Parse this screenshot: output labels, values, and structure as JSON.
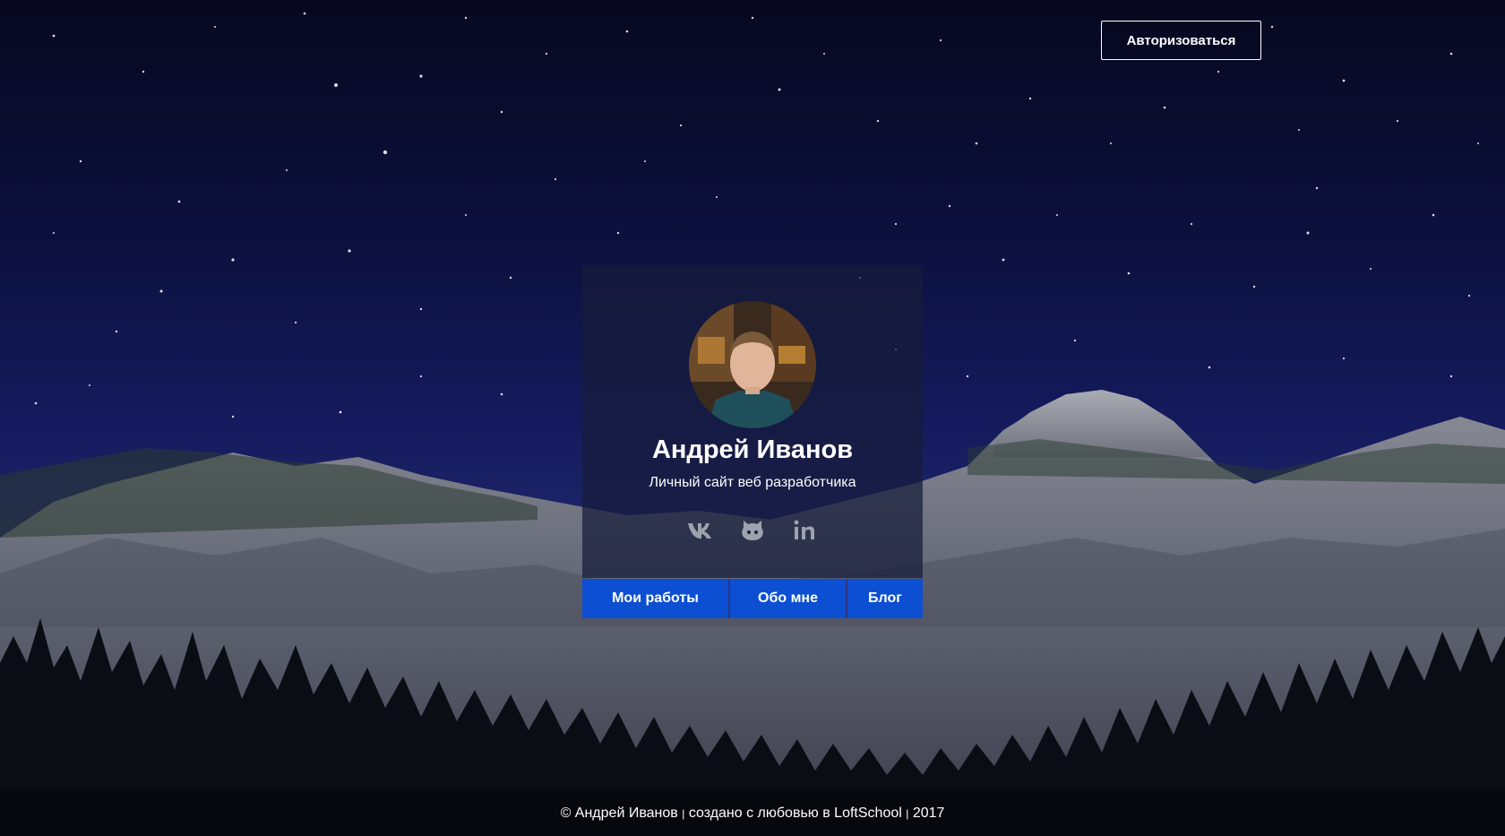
{
  "header": {
    "auth_label": "Авторизоваться"
  },
  "profile": {
    "name": "Андрей Иванов",
    "subtitle": "Личный сайт веб разработчика",
    "socials": [
      {
        "icon": "vk-icon"
      },
      {
        "icon": "github-icon"
      },
      {
        "icon": "linkedin-icon"
      }
    ]
  },
  "nav": {
    "works": "Мои работы",
    "about": "Обо мне",
    "blog": "Блог"
  },
  "footer": {
    "copyright": "© Андрей Иванов",
    "sep1": "|",
    "made_with": "создано с любовью в LoftSchool",
    "sep2": "|",
    "year": "2017"
  },
  "colors": {
    "accent": "#0d4fd2",
    "sky_dark": "#07081f",
    "sky_mid": "#141a5c",
    "text": "#ffffff"
  }
}
